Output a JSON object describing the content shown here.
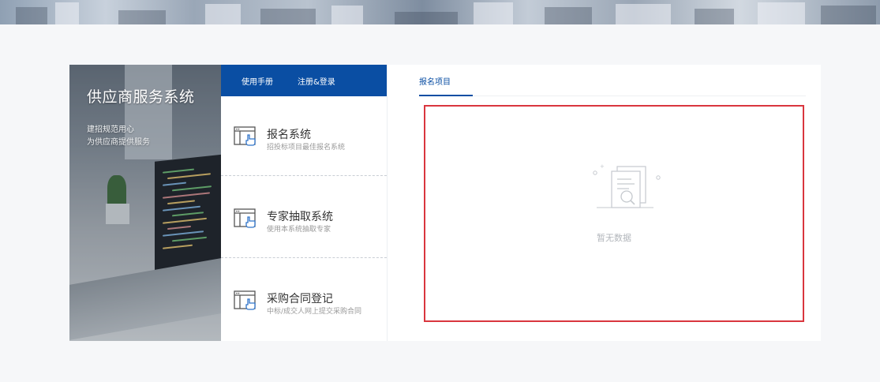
{
  "nav": {
    "manual_label": "使用手册",
    "register_login_label": "注册&登录"
  },
  "hero": {
    "title": "供应商服务系统",
    "subtitle_line1": "建招规范用心",
    "subtitle_line2": "为供应商提供服务"
  },
  "systems": [
    {
      "title": "报名系统",
      "desc": "招投标项目最佳报名系统",
      "icon": "window-hand-icon"
    },
    {
      "title": "专家抽取系统",
      "desc": "使用本系统抽取专家",
      "icon": "window-hand-icon"
    },
    {
      "title": "采购合同登记",
      "desc": "中标/成交人网上提交采购合同",
      "icon": "window-hand-icon"
    }
  ],
  "content": {
    "tab_label": "报名项目",
    "empty_text": "暂无数据"
  },
  "colors": {
    "primary": "#0a4ea3",
    "highlight_border": "#d9363e",
    "background": "#f6f7f9"
  }
}
